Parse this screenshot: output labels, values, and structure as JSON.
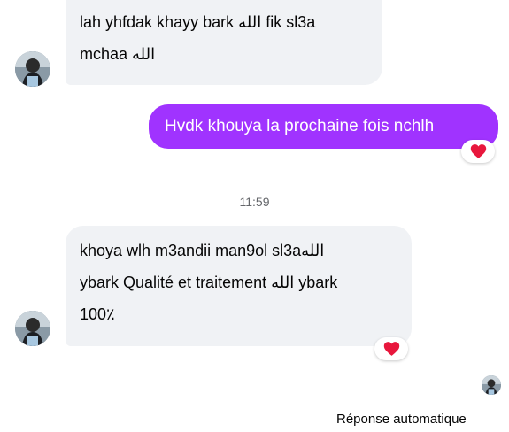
{
  "messages": [
    {
      "direction": "incoming",
      "text": "lah yhfdak khayy bark الله fik sl3a\nmchaa الله"
    },
    {
      "direction": "outgoing",
      "text": "Hvdk khouya la prochaine fois nchlh",
      "reaction": "heart"
    },
    {
      "direction": "incoming",
      "text": "khoya wlh m3andii man9ol sl3aالله\nybark Qualité et traitement الله ybark\n100٪",
      "reaction": "heart"
    }
  ],
  "timestamp": "11:59",
  "auto_reply_label": "Réponse automatique",
  "colors": {
    "outgoing_bubble": "#a033ff",
    "incoming_bubble": "#f0f2f5",
    "reaction_heart": "#e8173d",
    "timestamp_text": "#65676b"
  },
  "icons": {
    "reaction": "heart-icon",
    "seen_indicator": "avatar"
  }
}
